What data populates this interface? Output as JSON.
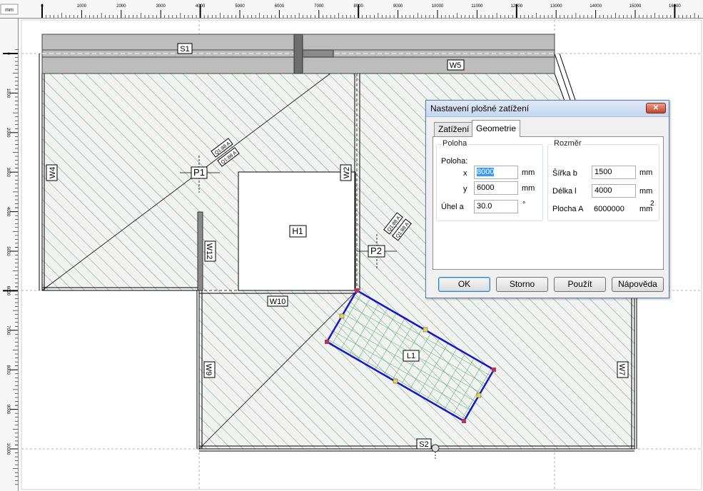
{
  "ruler": {
    "unit": "mm",
    "x_ticks": [
      "0",
      "1000",
      "2000",
      "3000",
      "4000",
      "5000",
      "6000",
      "7000",
      "8000",
      "9000",
      "10000",
      "11000",
      "12000",
      "13000",
      "14000",
      "15000",
      "16000"
    ],
    "y_ticks": [
      "0",
      "1000",
      "2000",
      "3000",
      "4000",
      "5000",
      "6000",
      "7000",
      "8000",
      "9000",
      "10000"
    ]
  },
  "drawing": {
    "labels": {
      "s1": "S1",
      "s2": "S2",
      "w5": "W5",
      "w4": "W4",
      "w2": "W2",
      "w12": "W12",
      "w10": "W10",
      "w9": "W9",
      "w7": "W7",
      "p1": "P1",
      "p2": "P2",
      "h1": "H1",
      "l1": "L1",
      "dim1a": "Q1:88 A",
      "dim1b": "Q1:88 A",
      "dim2a": "Q1:88 A",
      "dim2b": "Q1:88 A"
    },
    "colors": {
      "hatch": "#2a9a3a",
      "load": "#1818c8",
      "wall": "#a9a9a9",
      "handle": "#e6d84a"
    }
  },
  "dialog": {
    "title": "Nastavení plošné zatížení",
    "close_label": "✕",
    "tabs": [
      {
        "label": "Zatížení"
      },
      {
        "label": "Geometrie"
      }
    ],
    "position": {
      "legend": "Poloha",
      "caption": "Poloha:",
      "x_label": "x",
      "x_value": "8000",
      "x_unit": "mm",
      "y_label": "y",
      "y_value": "6000",
      "y_unit": "mm",
      "angle_label": "Úhel a",
      "angle_value": "30.0",
      "angle_unit": "°"
    },
    "size": {
      "legend": "Rozměr",
      "width_label": "Šířka b",
      "width_value": "1500",
      "width_unit": "mm",
      "length_label": "Délka l",
      "length_value": "4000",
      "length_unit": "mm",
      "area_label": "Plocha A",
      "area_value": "6000000",
      "area_unit": "mm",
      "area_exp": "2"
    },
    "buttons": {
      "ok": "OK",
      "cancel": "Storno",
      "apply": "Použít",
      "help": "Nápověda"
    }
  }
}
